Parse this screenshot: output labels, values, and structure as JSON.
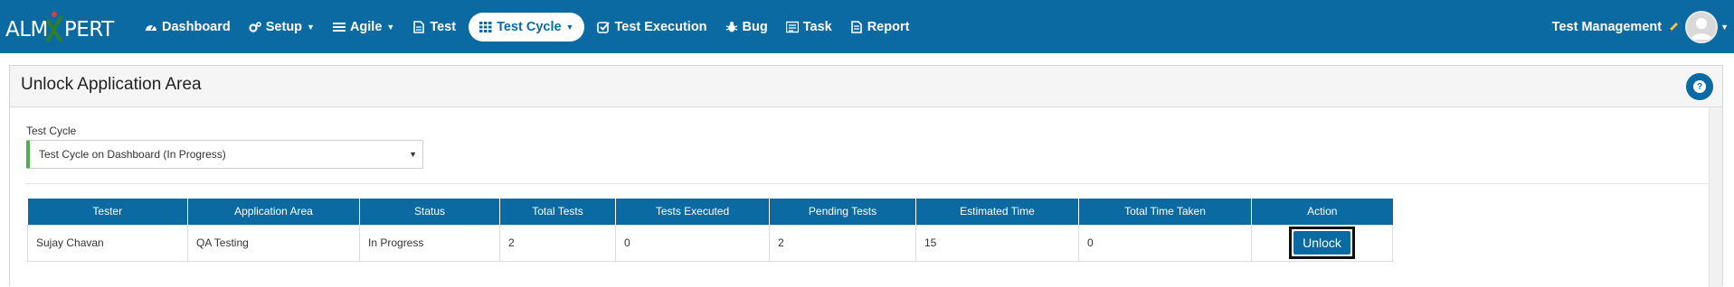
{
  "brand": {
    "left_text": "ALM",
    "right_text": "PERT"
  },
  "nav": {
    "items": [
      {
        "label": "Dashboard",
        "icon": "dashboard-icon",
        "caret": false,
        "active": false
      },
      {
        "label": "Setup",
        "icon": "gears-icon",
        "caret": true,
        "active": false
      },
      {
        "label": "Agile",
        "icon": "list-icon",
        "caret": true,
        "active": false
      },
      {
        "label": "Test",
        "icon": "file-icon",
        "caret": false,
        "active": false
      },
      {
        "label": "Test Cycle",
        "icon": "grid-icon",
        "caret": true,
        "active": true
      },
      {
        "label": "Test Execution",
        "icon": "check-square-icon",
        "caret": false,
        "active": false
      },
      {
        "label": "Bug",
        "icon": "bug-icon",
        "caret": false,
        "active": false
      },
      {
        "label": "Task",
        "icon": "tasks-icon",
        "caret": false,
        "active": false
      },
      {
        "label": "Report",
        "icon": "report-icon",
        "caret": false,
        "active": false
      }
    ],
    "right_label": "Test Management"
  },
  "panel": {
    "title": "Unlock Application Area",
    "help": "?"
  },
  "form": {
    "test_cycle_label": "Test Cycle",
    "test_cycle_value": "Test Cycle on Dashboard (In Progress)"
  },
  "table": {
    "columns": [
      "Tester",
      "Application Area",
      "Status",
      "Total Tests",
      "Tests Executed",
      "Pending Tests",
      "Estimated Time",
      "Total Time Taken",
      "Action"
    ],
    "rows": [
      {
        "tester": "Sujay Chavan",
        "application_area": "QA Testing",
        "status": "In Progress",
        "total_tests": "2",
        "tests_executed": "0",
        "pending_tests": "2",
        "estimated_time": "15",
        "total_time_taken": "0",
        "action": "Unlock"
      }
    ]
  },
  "colors": {
    "primary": "#0a6aa1",
    "accent_green": "#4caf50",
    "brand_x_red": "#e53935",
    "brand_x_green": "#2e7d32"
  }
}
